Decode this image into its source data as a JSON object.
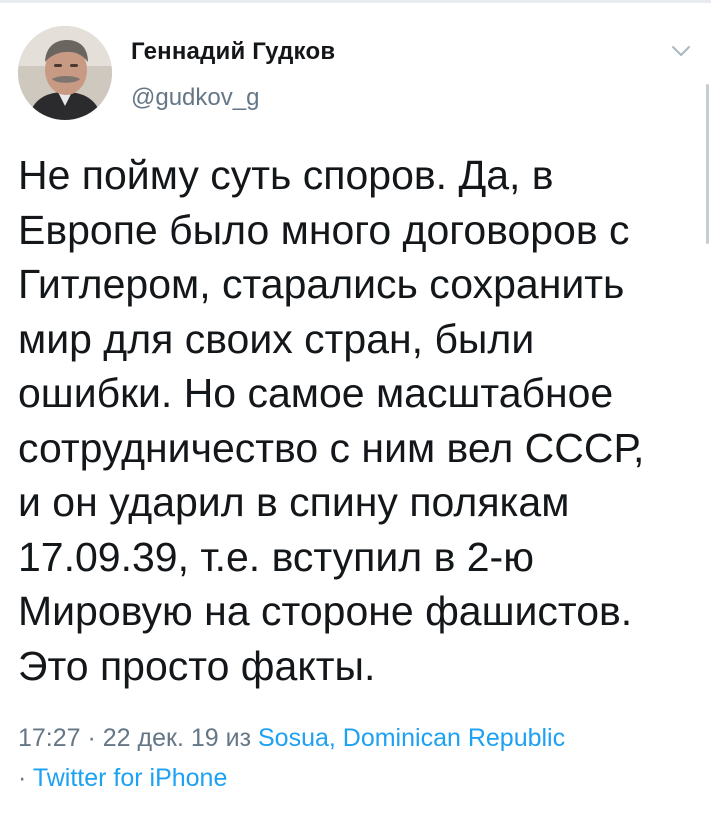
{
  "tweet": {
    "display_name": "Геннадий Гудков",
    "handle": "@gudkov_g",
    "text_lines": [
      "Не пойму суть споров. Да, в",
      "Европе было много договоров с",
      "Гитлером, старались сохранить",
      "мир для своих стран, были",
      "ошибки. Но самое масштабное",
      "сотрудничество с ним вел СССР,",
      "и он ударил в спину полякам",
      "17.09.39, т.е. вступил в 2-ю",
      "Мировую на стороне фашистов.",
      "Это просто факты."
    ],
    "time": "17:27",
    "separator": " · ",
    "date": "22 дек. 19",
    "from_word": " из ",
    "location": "Sosua, Dominican Republic",
    "separator2": "· ",
    "source": "Twitter for iPhone"
  },
  "icons": {
    "avatar": "avatar-photo",
    "menu": "chevron-down-icon"
  },
  "colors": {
    "text": "#14171a",
    "secondary": "#657786",
    "link": "#1da1f2"
  }
}
